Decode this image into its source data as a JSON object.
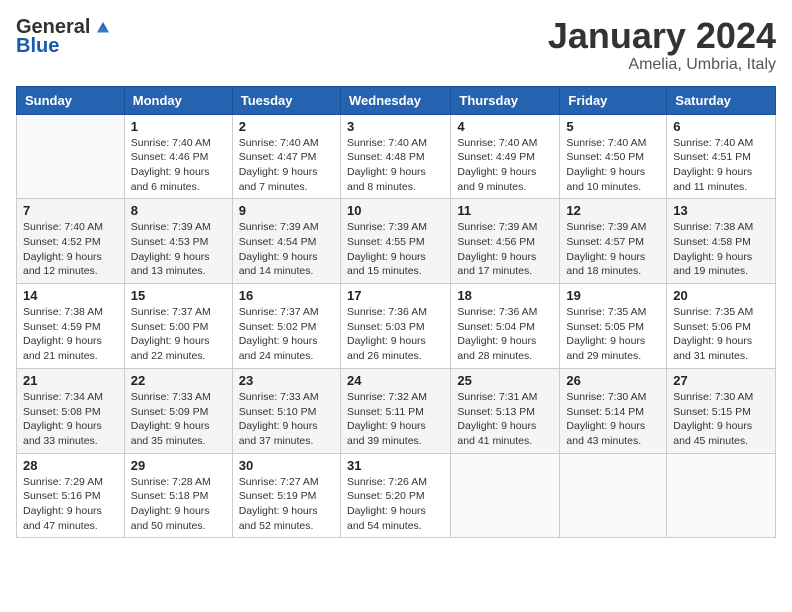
{
  "logo": {
    "general": "General",
    "blue": "Blue"
  },
  "title": "January 2024",
  "subtitle": "Amelia, Umbria, Italy",
  "days_of_week": [
    "Sunday",
    "Monday",
    "Tuesday",
    "Wednesday",
    "Thursday",
    "Friday",
    "Saturday"
  ],
  "weeks": [
    [
      {
        "day": "",
        "info": ""
      },
      {
        "day": "1",
        "info": "Sunrise: 7:40 AM\nSunset: 4:46 PM\nDaylight: 9 hours\nand 6 minutes."
      },
      {
        "day": "2",
        "info": "Sunrise: 7:40 AM\nSunset: 4:47 PM\nDaylight: 9 hours\nand 7 minutes."
      },
      {
        "day": "3",
        "info": "Sunrise: 7:40 AM\nSunset: 4:48 PM\nDaylight: 9 hours\nand 8 minutes."
      },
      {
        "day": "4",
        "info": "Sunrise: 7:40 AM\nSunset: 4:49 PM\nDaylight: 9 hours\nand 9 minutes."
      },
      {
        "day": "5",
        "info": "Sunrise: 7:40 AM\nSunset: 4:50 PM\nDaylight: 9 hours\nand 10 minutes."
      },
      {
        "day": "6",
        "info": "Sunrise: 7:40 AM\nSunset: 4:51 PM\nDaylight: 9 hours\nand 11 minutes."
      }
    ],
    [
      {
        "day": "7",
        "info": "Sunrise: 7:40 AM\nSunset: 4:52 PM\nDaylight: 9 hours\nand 12 minutes."
      },
      {
        "day": "8",
        "info": "Sunrise: 7:39 AM\nSunset: 4:53 PM\nDaylight: 9 hours\nand 13 minutes."
      },
      {
        "day": "9",
        "info": "Sunrise: 7:39 AM\nSunset: 4:54 PM\nDaylight: 9 hours\nand 14 minutes."
      },
      {
        "day": "10",
        "info": "Sunrise: 7:39 AM\nSunset: 4:55 PM\nDaylight: 9 hours\nand 15 minutes."
      },
      {
        "day": "11",
        "info": "Sunrise: 7:39 AM\nSunset: 4:56 PM\nDaylight: 9 hours\nand 17 minutes."
      },
      {
        "day": "12",
        "info": "Sunrise: 7:39 AM\nSunset: 4:57 PM\nDaylight: 9 hours\nand 18 minutes."
      },
      {
        "day": "13",
        "info": "Sunrise: 7:38 AM\nSunset: 4:58 PM\nDaylight: 9 hours\nand 19 minutes."
      }
    ],
    [
      {
        "day": "14",
        "info": "Sunrise: 7:38 AM\nSunset: 4:59 PM\nDaylight: 9 hours\nand 21 minutes."
      },
      {
        "day": "15",
        "info": "Sunrise: 7:37 AM\nSunset: 5:00 PM\nDaylight: 9 hours\nand 22 minutes."
      },
      {
        "day": "16",
        "info": "Sunrise: 7:37 AM\nSunset: 5:02 PM\nDaylight: 9 hours\nand 24 minutes."
      },
      {
        "day": "17",
        "info": "Sunrise: 7:36 AM\nSunset: 5:03 PM\nDaylight: 9 hours\nand 26 minutes."
      },
      {
        "day": "18",
        "info": "Sunrise: 7:36 AM\nSunset: 5:04 PM\nDaylight: 9 hours\nand 28 minutes."
      },
      {
        "day": "19",
        "info": "Sunrise: 7:35 AM\nSunset: 5:05 PM\nDaylight: 9 hours\nand 29 minutes."
      },
      {
        "day": "20",
        "info": "Sunrise: 7:35 AM\nSunset: 5:06 PM\nDaylight: 9 hours\nand 31 minutes."
      }
    ],
    [
      {
        "day": "21",
        "info": "Sunrise: 7:34 AM\nSunset: 5:08 PM\nDaylight: 9 hours\nand 33 minutes."
      },
      {
        "day": "22",
        "info": "Sunrise: 7:33 AM\nSunset: 5:09 PM\nDaylight: 9 hours\nand 35 minutes."
      },
      {
        "day": "23",
        "info": "Sunrise: 7:33 AM\nSunset: 5:10 PM\nDaylight: 9 hours\nand 37 minutes."
      },
      {
        "day": "24",
        "info": "Sunrise: 7:32 AM\nSunset: 5:11 PM\nDaylight: 9 hours\nand 39 minutes."
      },
      {
        "day": "25",
        "info": "Sunrise: 7:31 AM\nSunset: 5:13 PM\nDaylight: 9 hours\nand 41 minutes."
      },
      {
        "day": "26",
        "info": "Sunrise: 7:30 AM\nSunset: 5:14 PM\nDaylight: 9 hours\nand 43 minutes."
      },
      {
        "day": "27",
        "info": "Sunrise: 7:30 AM\nSunset: 5:15 PM\nDaylight: 9 hours\nand 45 minutes."
      }
    ],
    [
      {
        "day": "28",
        "info": "Sunrise: 7:29 AM\nSunset: 5:16 PM\nDaylight: 9 hours\nand 47 minutes."
      },
      {
        "day": "29",
        "info": "Sunrise: 7:28 AM\nSunset: 5:18 PM\nDaylight: 9 hours\nand 50 minutes."
      },
      {
        "day": "30",
        "info": "Sunrise: 7:27 AM\nSunset: 5:19 PM\nDaylight: 9 hours\nand 52 minutes."
      },
      {
        "day": "31",
        "info": "Sunrise: 7:26 AM\nSunset: 5:20 PM\nDaylight: 9 hours\nand 54 minutes."
      },
      {
        "day": "",
        "info": ""
      },
      {
        "day": "",
        "info": ""
      },
      {
        "day": "",
        "info": ""
      }
    ]
  ]
}
